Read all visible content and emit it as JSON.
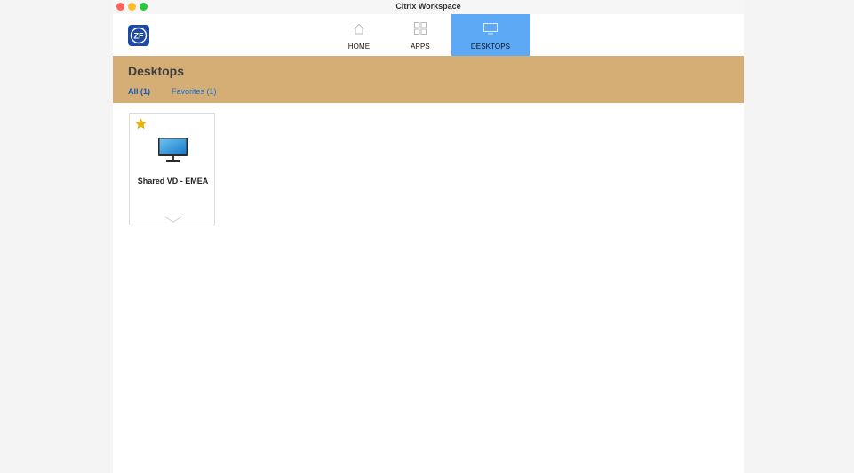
{
  "window": {
    "title": "Citrix Workspace"
  },
  "nav": {
    "home": {
      "label": "HOME",
      "icon": "home-icon"
    },
    "apps": {
      "label": "APPS",
      "icon": "apps-grid-icon"
    },
    "desktops": {
      "label": "DESKTOPS",
      "icon": "desktop-icon",
      "active": true
    }
  },
  "logo": {
    "text": "ZF"
  },
  "page": {
    "title": "Desktops",
    "filters": [
      {
        "label": "All (1)",
        "active": true
      },
      {
        "label": "Favorites (1)",
        "active": false
      }
    ]
  },
  "desktops": [
    {
      "name": "Shared VD - EMEA",
      "favorite": true,
      "icon": "monitor-icon"
    }
  ],
  "colors": {
    "header_band": "#d4ae74",
    "active_tab": "#5ea9f5",
    "link": "#1a6fd8",
    "star": "#f0b400",
    "logo": "#1d4aa6"
  }
}
